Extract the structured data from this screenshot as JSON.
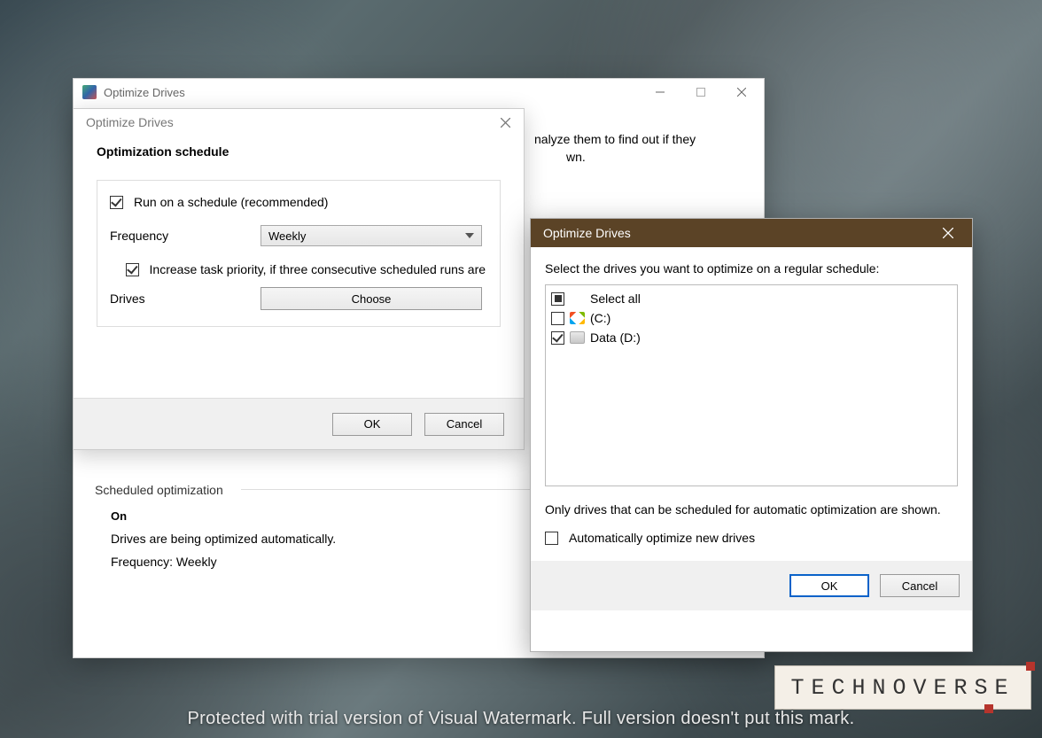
{
  "main_window": {
    "title": "Optimize Drives",
    "hint_fragments": {
      "line1_tail": "nalyze them to find out if they",
      "line2_tail": "wn."
    },
    "section_header": "Scheduled optimization",
    "status_label": "On",
    "status_line1": "Drives are being optimized automatically.",
    "status_line2": "Frequency: Weekly"
  },
  "schedule_dialog": {
    "title": "Optimize Drives",
    "heading": "Optimization schedule",
    "run_schedule_label": "Run on a schedule (recommended)",
    "run_schedule_checked": true,
    "frequency_label": "Frequency",
    "frequency_value": "Weekly",
    "increase_priority_label": "Increase task priority, if three consecutive scheduled runs are m",
    "increase_priority_checked": true,
    "drives_label": "Drives",
    "choose_button": "Choose",
    "ok": "OK",
    "cancel": "Cancel"
  },
  "drive_select_dialog": {
    "title": "Optimize Drives",
    "instruction": "Select the drives you want to optimize on a regular schedule:",
    "select_all_label": "Select all",
    "select_all_state": "mixed",
    "drives": [
      {
        "label": "(C:)",
        "checked": false,
        "icon": "windows"
      },
      {
        "label": "Data (D:)",
        "checked": true,
        "icon": "disk"
      }
    ],
    "note": "Only drives that can be scheduled for automatic optimization are shown.",
    "auto_new_label": "Automatically optimize new drives",
    "auto_new_checked": false,
    "ok": "OK",
    "cancel": "Cancel"
  },
  "watermark": "Protected with trial version of Visual Watermark. Full version doesn't put this mark.",
  "brand": "TECHNOVERSE"
}
